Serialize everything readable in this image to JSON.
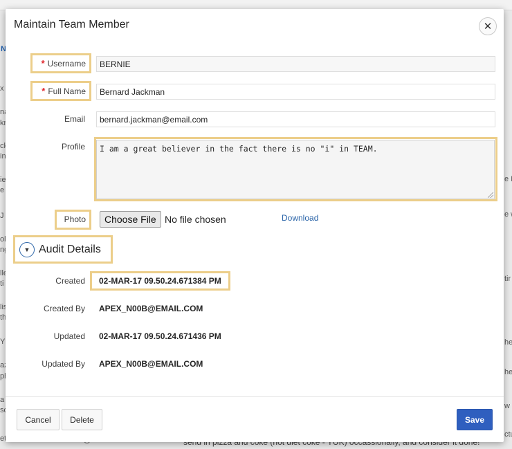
{
  "dialog": {
    "title": "Maintain Team Member",
    "close_glyph": "✕"
  },
  "form": {
    "username": {
      "label": "Username",
      "required_marker": "*",
      "value": "BERNIE"
    },
    "full_name": {
      "label": "Full Name",
      "required_marker": "*",
      "value": "Bernard Jackman"
    },
    "email": {
      "label": "Email",
      "value": "bernard.jackman@email.com"
    },
    "profile": {
      "label": "Profile",
      "value": "I am a great believer in the fact there is no \"i\" in TEAM."
    },
    "photo": {
      "label": "Photo",
      "choose_button": "Choose File",
      "status": "No file chosen",
      "download_link": "Download"
    }
  },
  "audit": {
    "toggle_glyph": "▼",
    "title": "Audit Details",
    "rows": [
      {
        "label": "Created",
        "value": "02-MAR-17 09.50.24.671384 PM"
      },
      {
        "label": "Created By",
        "value": "APEX_N00B@EMAIL.COM"
      },
      {
        "label": "Updated",
        "value": "02-MAR-17 09.50.24.671436 PM"
      },
      {
        "label": "Updated By",
        "value": "APEX_N00B@EMAIL.COM"
      }
    ]
  },
  "footer": {
    "cancel": "Cancel",
    "delete": "Delete",
    "save": "Save"
  },
  "background": {
    "left_fragments": [
      "N",
      "x",
      "na",
      "kn",
      "ck",
      "in",
      "ie",
      "e",
      "J",
      "ole",
      "ng",
      "lle",
      "ti",
      "lis",
      "th",
      "Y",
      "az",
      "ph",
      "a",
      "so",
      "eta Tran"
    ],
    "right_fragments": [
      "e I",
      "e w",
      "tir",
      "he",
      "he",
      "w",
      "ctus"
    ],
    "bottom_left": "tanimania@email.com",
    "bottom_text": "send in pizza and coke (not diet coke - YUK) occassionally, and consider it done!"
  },
  "colors": {
    "highlight": "#ecce8a",
    "required": "#e0262c",
    "primary": "#2f5fbf",
    "link": "#2a64a8"
  }
}
